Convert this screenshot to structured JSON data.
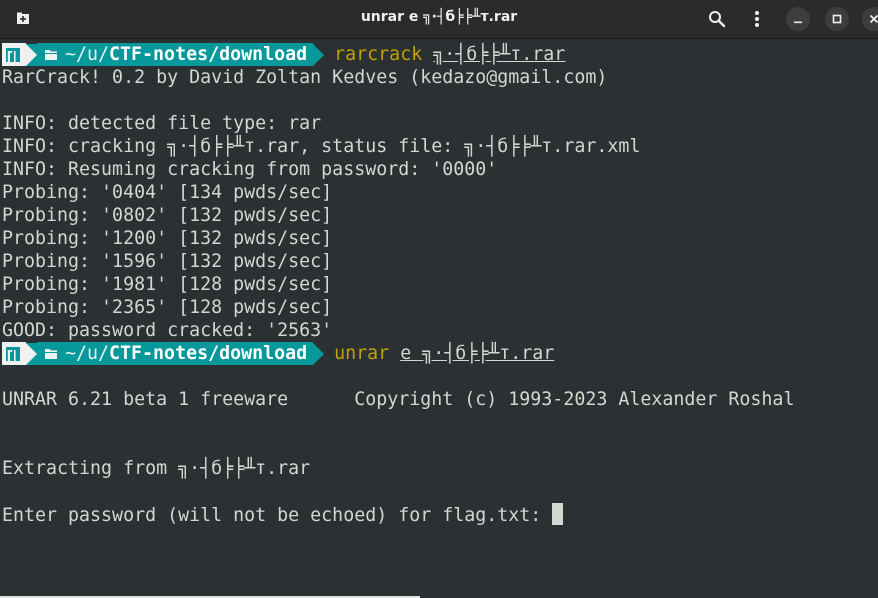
{
  "window": {
    "title": "unrar e ╗·┤б╞╞╨т.rar"
  },
  "colors": {
    "background": "#2b3033",
    "text": "#d3d7cf",
    "prompt_os_bg": "#f0f0f0",
    "prompt_path_bg": "#06989a",
    "command_highlight": "#c4a000"
  },
  "icons": {
    "new_tab": "new-tab-icon",
    "search": "search-icon",
    "menu": "kebab-menu-icon",
    "minimize": "minimize-icon",
    "maximize": "maximize-icon",
    "close": "close-icon",
    "os_logo": "manjaro-logo-icon",
    "folder": "folder-icon"
  },
  "prompt": {
    "path_tilde": "~/",
    "path_u": "u/",
    "path_rest": "CTF-notes/download"
  },
  "session": [
    {
      "type": "prompt",
      "cmd": "rarcrack",
      "arg": "╗·┤б╞╞╨т.rar"
    },
    {
      "type": "text",
      "text": "RarCrack! 0.2 by David Zoltan Kedves (kedazo@gmail.com)"
    },
    {
      "type": "blank"
    },
    {
      "type": "text",
      "text": "INFO: detected file type: rar"
    },
    {
      "type": "text",
      "text": "INFO: cracking ╗·┤б╞╞╨т.rar, status file: ╗·┤б╞╞╨т.rar.xml"
    },
    {
      "type": "text",
      "text": "INFO: Resuming cracking from password: '0000'"
    },
    {
      "type": "text",
      "text": "Probing: '0404' [134 pwds/sec]"
    },
    {
      "type": "text",
      "text": "Probing: '0802' [132 pwds/sec]"
    },
    {
      "type": "text",
      "text": "Probing: '1200' [132 pwds/sec]"
    },
    {
      "type": "text",
      "text": "Probing: '1596' [132 pwds/sec]"
    },
    {
      "type": "text",
      "text": "Probing: '1981' [128 pwds/sec]"
    },
    {
      "type": "text",
      "text": "Probing: '2365' [128 pwds/sec]"
    },
    {
      "type": "text",
      "text": "GOOD: password cracked: '2563'"
    },
    {
      "type": "prompt",
      "cmd": "unrar",
      "arg": "e ╗·┤б╞╞╨т.rar"
    },
    {
      "type": "blank"
    },
    {
      "type": "text",
      "text": "UNRAR 6.21 beta 1 freeware      Copyright (c) 1993-2023 Alexander Roshal"
    },
    {
      "type": "blank"
    },
    {
      "type": "blank"
    },
    {
      "type": "text",
      "text": "Extracting from ╗·┤б╞╞╨т.rar"
    },
    {
      "type": "blank"
    },
    {
      "type": "text",
      "text": "Enter password (will not be echoed) for flag.txt: "
    }
  ]
}
